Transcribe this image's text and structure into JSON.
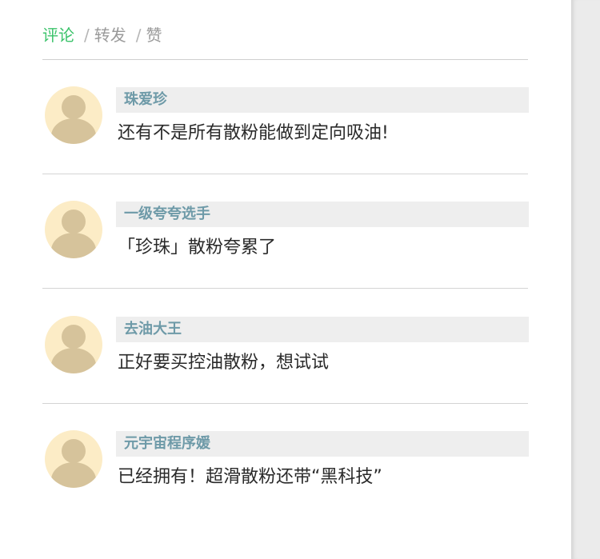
{
  "tabs": [
    {
      "label": "评论",
      "active": true
    },
    {
      "label": "转发",
      "active": false
    },
    {
      "label": "赞",
      "active": false
    }
  ],
  "tab_separator": "/",
  "colors": {
    "accent": "#3cc36b",
    "username": "#6e9aa8",
    "avatar_bg": "#fcecc6",
    "avatar_figure": "#d6c39b"
  },
  "comments": [
    {
      "username": "珠爱珍",
      "text": "还有不是所有散粉能做到定向吸油!",
      "avatar_icon": "default-user-avatar"
    },
    {
      "username": "一级夸夸选手",
      "text": "「珍珠」散粉夸累了",
      "avatar_icon": "default-user-avatar"
    },
    {
      "username": "去油大王",
      "text": "正好要买控油散粉，想试试",
      "avatar_icon": "default-user-avatar"
    },
    {
      "username": "元宇宙程序媛",
      "text": "已经拥有！超滑散粉还带“黑科技”",
      "avatar_icon": "default-user-avatar"
    }
  ]
}
